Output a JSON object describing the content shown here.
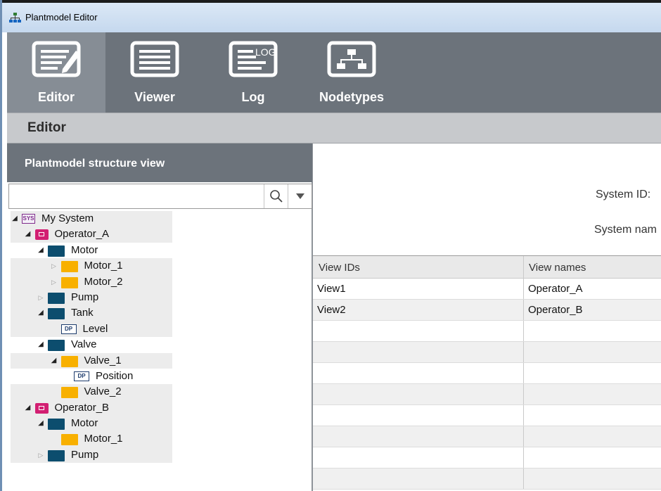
{
  "window": {
    "title": "Plantmodel Editor"
  },
  "toolbar": {
    "buttons": [
      {
        "label": "Editor",
        "icon": "editor-icon",
        "active": true
      },
      {
        "label": "Viewer",
        "icon": "viewer-icon",
        "active": false
      },
      {
        "label": "Log",
        "icon": "log-icon",
        "active": false
      },
      {
        "label": "Nodetypes",
        "icon": "nodetypes-icon",
        "active": false
      }
    ],
    "log_icon_text": "LOG"
  },
  "section": {
    "title": "Editor"
  },
  "left_panel": {
    "title": "Plantmodel structure view",
    "search": {
      "value": "",
      "placeholder": ""
    }
  },
  "tree": {
    "items": [
      {
        "label": "My System",
        "icon": "system-icon",
        "icon_text": "SYS",
        "toggle": "expanded",
        "level": 0,
        "shaded": true
      },
      {
        "label": "Operator_A",
        "icon": "operator-icon",
        "toggle": "expanded",
        "level": 1,
        "shaded": true
      },
      {
        "label": "Motor",
        "icon": "type-node-icon",
        "toggle": "expanded",
        "level": 2,
        "shaded": false
      },
      {
        "label": "Motor_1",
        "icon": "instance-node-icon",
        "toggle": "collapsed",
        "level": 3,
        "shaded": true
      },
      {
        "label": "Motor_2",
        "icon": "instance-node-icon",
        "toggle": "collapsed",
        "level": 3,
        "shaded": true
      },
      {
        "label": "Pump",
        "icon": "type-node-icon",
        "toggle": "collapsed",
        "level": 2,
        "shaded": true
      },
      {
        "label": "Tank",
        "icon": "type-node-icon",
        "toggle": "expanded",
        "level": 2,
        "shaded": true
      },
      {
        "label": "Level",
        "icon": "datapoint-icon",
        "icon_text": "DP",
        "toggle": "none",
        "level": 3,
        "shaded": true
      },
      {
        "label": "Valve",
        "icon": "type-node-icon",
        "toggle": "expanded",
        "level": 2,
        "shaded": false
      },
      {
        "label": "Valve_1",
        "icon": "instance-node-icon",
        "toggle": "expanded",
        "level": 3,
        "shaded": true
      },
      {
        "label": "Position",
        "icon": "datapoint-icon",
        "icon_text": "DP",
        "toggle": "none",
        "level": 4,
        "shaded": false
      },
      {
        "label": "Valve_2",
        "icon": "instance-node-icon",
        "toggle": "none",
        "level": 3,
        "shaded": true
      },
      {
        "label": "Operator_B",
        "icon": "operator-icon",
        "toggle": "expanded",
        "level": 1,
        "shaded": true
      },
      {
        "label": "Motor",
        "icon": "type-node-icon",
        "toggle": "expanded",
        "level": 2,
        "shaded": true
      },
      {
        "label": "Motor_1",
        "icon": "instance-node-icon",
        "toggle": "none",
        "level": 3,
        "shaded": true
      },
      {
        "label": "Pump",
        "icon": "type-node-icon",
        "toggle": "collapsed",
        "level": 2,
        "shaded": true
      }
    ]
  },
  "form": {
    "system_id_label": "System ID:",
    "system_name_label": "System nam"
  },
  "grid": {
    "columns": [
      "View IDs",
      "View names"
    ],
    "rows": [
      [
        "View1",
        "Operator_A"
      ],
      [
        "View2",
        "Operator_B"
      ],
      [
        "",
        ""
      ],
      [
        "",
        ""
      ],
      [
        "",
        ""
      ],
      [
        "",
        ""
      ],
      [
        "",
        ""
      ],
      [
        "",
        ""
      ],
      [
        "",
        ""
      ],
      [
        "",
        ""
      ]
    ]
  },
  "colors": {
    "toolbar": "#6c737b",
    "toolbar_active": "#868d95",
    "operator": "#d21f72",
    "type_node": "#0c4d6e",
    "instance_node": "#f8b000"
  }
}
